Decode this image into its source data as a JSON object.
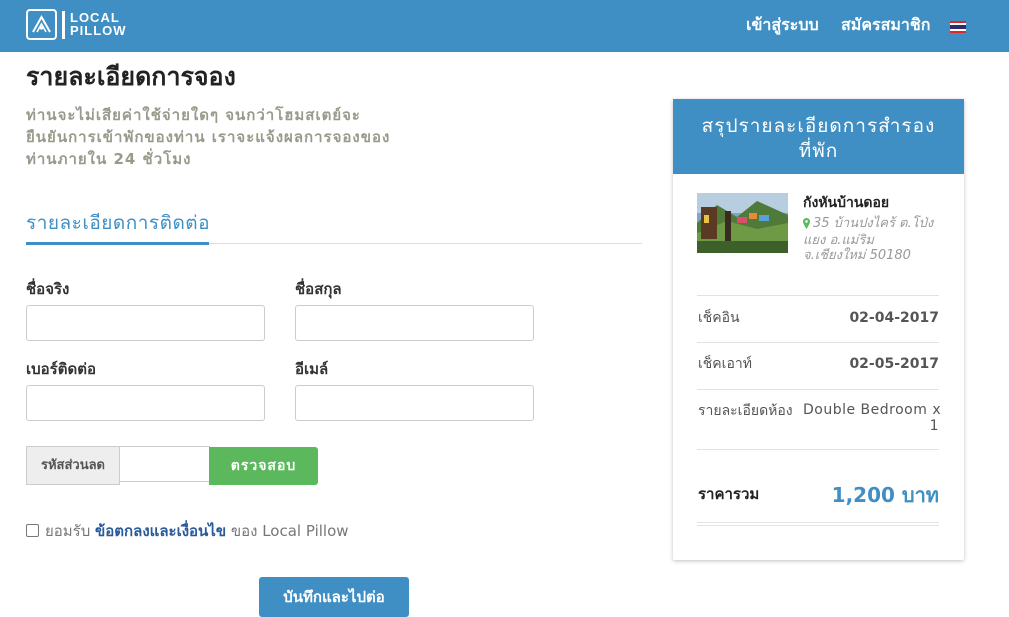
{
  "navbar": {
    "logo_line1": "LOCAL",
    "logo_line2": "PILLOW",
    "login_label": "เข้าสู่ระบบ",
    "register_label": "สมัครสมาชิก",
    "language_icon": "thai-flag-icon",
    "background_color": "#3f8fc4"
  },
  "main": {
    "title": "รายละเอียดการจอง",
    "intro_lines": [
      "ท่านจะไม่เสียค่าใช้จ่ายใดๆ จนกว่าโฮมสเตย์จะ",
      "ยืนยันการเข้าพักของท่าน เราจะแจ้งผลการจองของ",
      "ท่านภายใน 24 ชั่วโมง"
    ],
    "contact_section_title": "รายละเอียดการติดต่อ",
    "form": {
      "first_name_label": "ชื่อจริง",
      "first_name_value": "",
      "last_name_label": "ชื่อสกุล",
      "last_name_value": "",
      "phone_label": "เบอร์ติดต่อ",
      "phone_value": "",
      "email_label": "อีเมล์",
      "email_value": ""
    },
    "coupon": {
      "label": "รหัสส่วนลด",
      "value": "",
      "check_button": "ตรวจสอบ"
    },
    "agreement": {
      "checked": false,
      "prefix": "ยอมรับ",
      "link_text": "ข้อตกลงและเงื่อนไข",
      "suffix": "ของ Local Pillow"
    },
    "submit_button": "บันทึกและไปต่อ"
  },
  "summary": {
    "header_line1": "สรุปรายละเอียดการสำรอง",
    "header_line2": "ที่พัก",
    "hotel_name": "กังหันบ้านดอย",
    "address_lines": [
      "35 บ้านปงไคร้ ต.โป่ง",
      "แยง อ.แม่ริม",
      "จ.เชียงใหม่ 50180"
    ],
    "checkin_label": "เช็คอิน",
    "checkin_value": "02-04-2017",
    "checkout_label": "เช็คเอาท์",
    "checkout_value": "02-05-2017",
    "room_label": "รายละเอียดห้อง",
    "room_value_lines": [
      "Double Bedroom x",
      "1"
    ],
    "total_label": "ราคารวม",
    "total_value": "1,200 บาท",
    "accent_color": "#3f8fc4"
  }
}
